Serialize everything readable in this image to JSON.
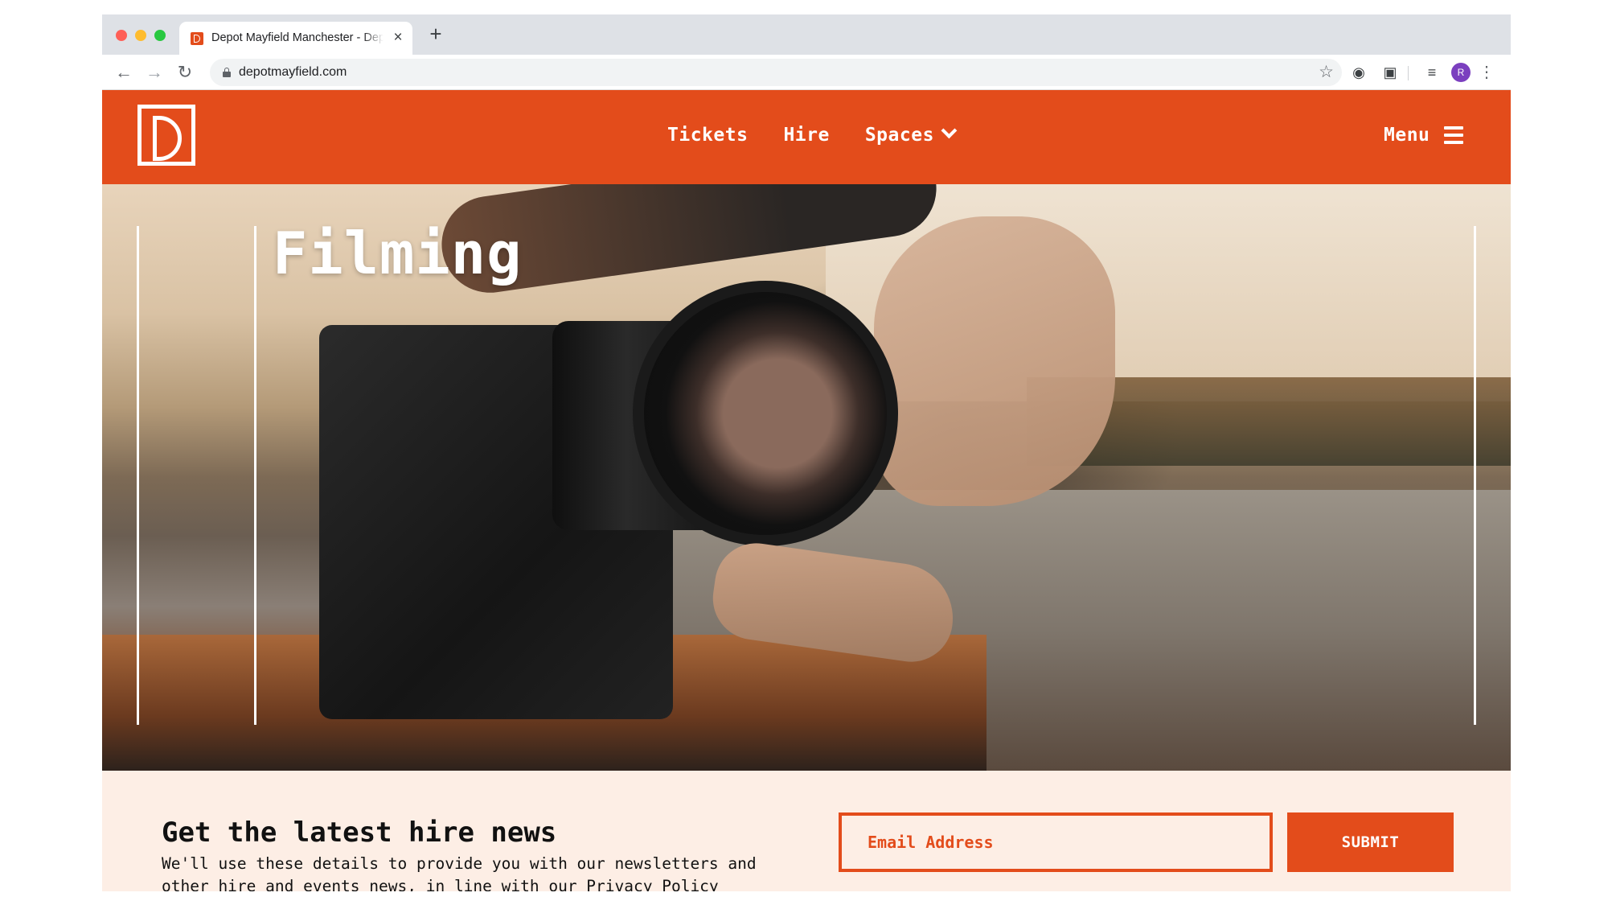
{
  "browser": {
    "tab_title": "Depot Mayfield Manchester - Depot",
    "tab_close": "×",
    "new_tab": "+",
    "url": "depotmayfield.com",
    "profile_initial": "R",
    "icons": [
      "back-icon",
      "forward-icon",
      "reload-icon",
      "lock-icon",
      "star-icon",
      "extension-icon",
      "screenshot-icon",
      "reading-list-icon",
      "menu-icon"
    ]
  },
  "site": {
    "brand_color": "#e34c1b",
    "nav": {
      "tickets": "Tickets",
      "hire": "Hire",
      "spaces": "Spaces",
      "menu": "Menu"
    },
    "hero": {
      "title": "Filming"
    },
    "newsletter": {
      "title": "Get the latest hire news",
      "text": "We'll use these details to provide you with our newsletters and other hire and events news, in line with our Privacy Policy",
      "email_placeholder": "Email Address",
      "submit_label": "SUBMIT",
      "background": "#fdeee5"
    }
  }
}
